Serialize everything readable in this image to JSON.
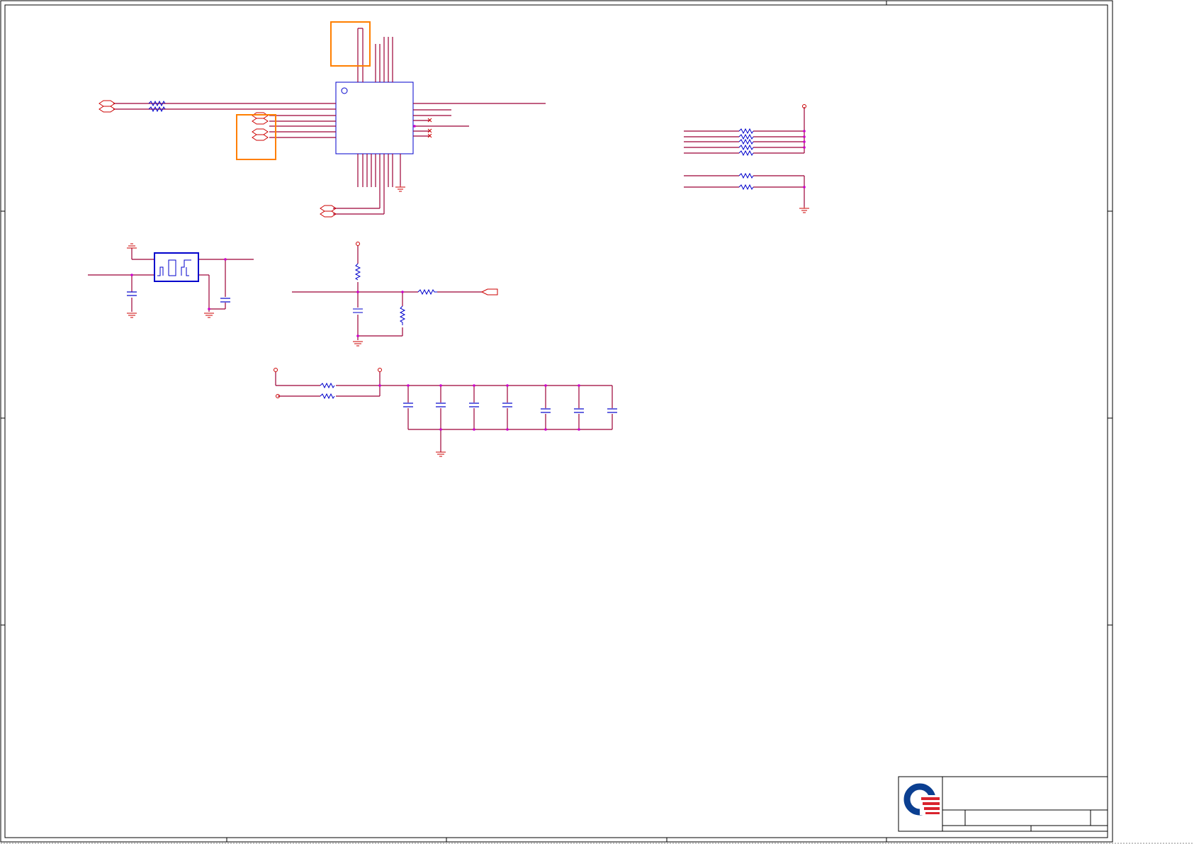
{
  "document": {
    "kind": "schematic-sheet",
    "colors": {
      "wire": "#9c0036",
      "pin": "#cc0000",
      "component": "#0000cc",
      "junction": "#cc00cc",
      "highlight": "#ff7f00",
      "border": "#000000",
      "logo_blue": "#0b3f91",
      "logo_red": "#d9232d"
    }
  },
  "title_block": {
    "logo": "company-logo",
    "title": "",
    "size": "",
    "document_number": "",
    "revision": "",
    "date": "",
    "sheet": ""
  },
  "annotations": {
    "highlight_boxes": 2,
    "note": ""
  }
}
